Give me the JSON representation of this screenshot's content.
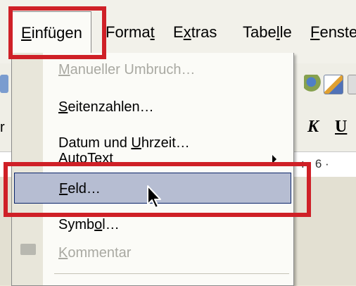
{
  "menubar": {
    "items": [
      {
        "pre": "",
        "acc": "E",
        "post": "infügen"
      },
      {
        "pre": "Forma",
        "acc": "t",
        "post": ""
      },
      {
        "pre": "E",
        "acc": "x",
        "post": "tras"
      },
      {
        "pre": "Tabe",
        "acc": "l",
        "post": "le"
      },
      {
        "pre": "",
        "acc": "F",
        "post": "enste"
      }
    ]
  },
  "toolbar": {
    "italic_label": "K",
    "underline_label": "U",
    "ruler_text": "ı · 6 ·",
    "left_fragment": "r"
  },
  "dropdown": {
    "items": [
      {
        "pre": "",
        "acc": "M",
        "post": "anueller Umbruch…"
      },
      {
        "pre": "",
        "acc": "S",
        "post": "eitenzahlen…"
      },
      {
        "pre": "Datum und ",
        "acc": "U",
        "post": "hrzeit…"
      },
      {
        "pre": "AutoTe",
        "acc": "x",
        "post": "t"
      },
      {
        "pre": "",
        "acc": "F",
        "post": "eld…"
      },
      {
        "pre": "Symb",
        "acc": "o",
        "post": "l…"
      },
      {
        "pre": "",
        "acc": "K",
        "post": "ommentar"
      }
    ]
  },
  "colors": {
    "highlight_box": "#cf2027",
    "hover_fill": "#b6bdd2",
    "hover_border": "#0a246a"
  }
}
